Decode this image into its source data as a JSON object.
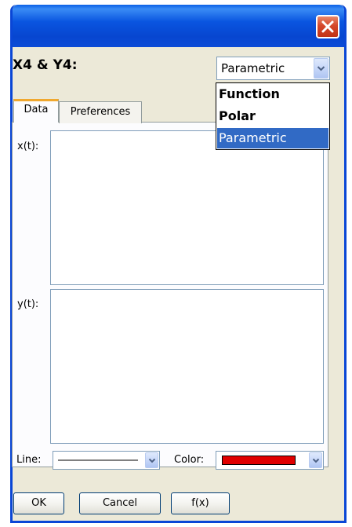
{
  "dialog": {
    "heading": "X4 & Y4:",
    "close_icon": "close-icon"
  },
  "mode_select": {
    "selected": "Parametric",
    "options": [
      "Function",
      "Polar",
      "Parametric"
    ],
    "highlighted": "Parametric"
  },
  "tabs": [
    {
      "label": "Data",
      "active": true
    },
    {
      "label": "Preferences",
      "active": false
    }
  ],
  "data_tab": {
    "x_label": "x(t):",
    "x_value": "",
    "y_label": "y(t):",
    "y_value": ""
  },
  "line": {
    "label": "Line:",
    "style": "solid"
  },
  "color": {
    "label": "Color:",
    "value": "#e00000"
  },
  "buttons": {
    "ok": "OK",
    "cancel": "Cancel",
    "fx": "f(x)"
  },
  "colors": {
    "titlebar": "#0a55e0",
    "dialog_bg": "#ece9d8",
    "selection": "#316ac5",
    "active_tab_accent": "#f0a82f"
  }
}
